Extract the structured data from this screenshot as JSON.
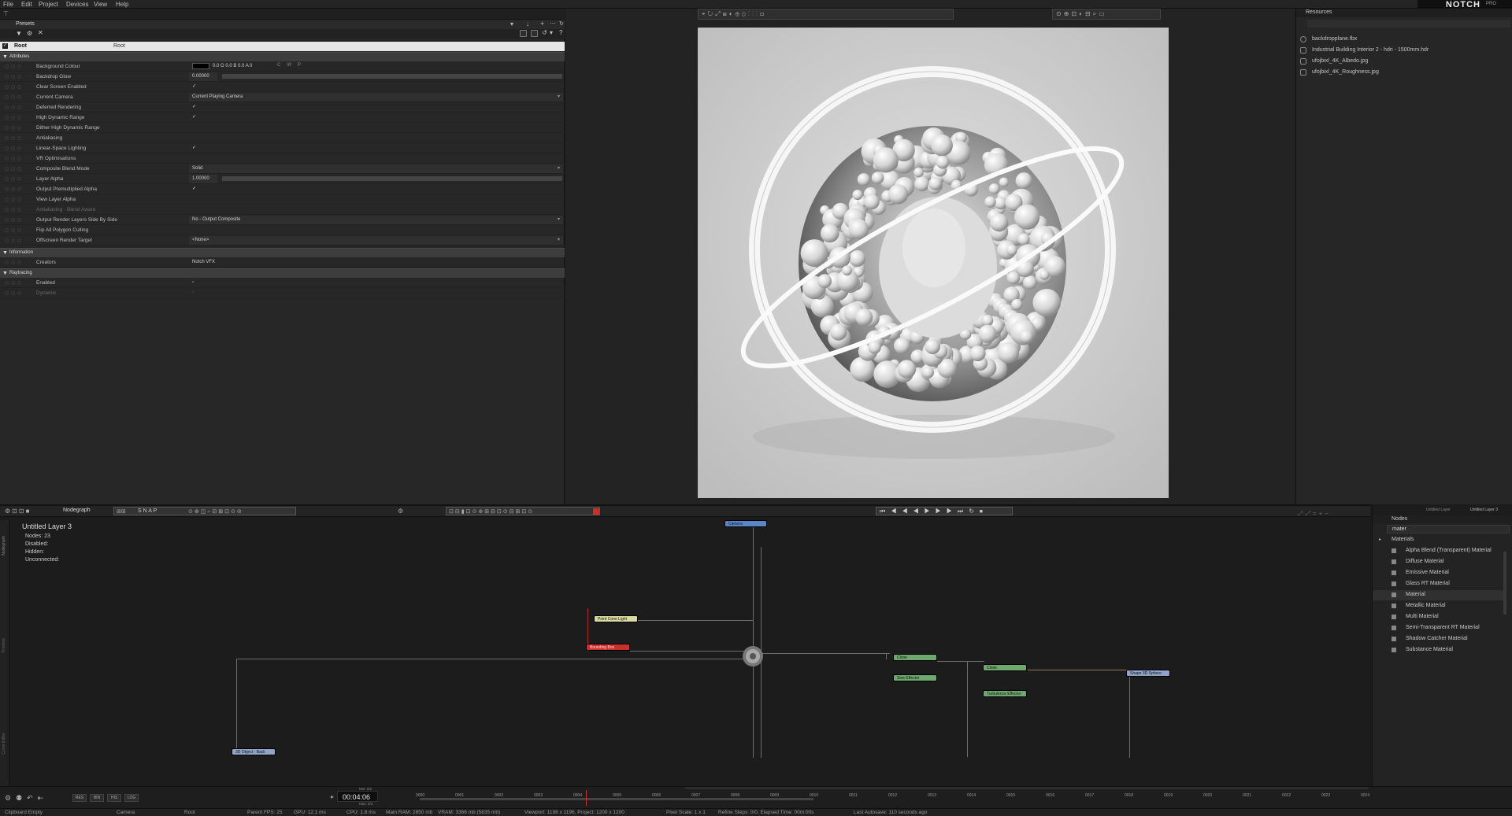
{
  "menu": [
    "File",
    "Edit",
    "Project",
    "Devices",
    "View",
    "Help"
  ],
  "brand": {
    "logo": "NOTCH",
    "edition": "PRO"
  },
  "properties": {
    "presets_label": "Presets",
    "root_label": "Root",
    "root_value": "Root",
    "attributes_header": "Attributes",
    "rows": [
      {
        "label": "Background Colour",
        "value": "0.0 G 0.0 B 0.0 A 0",
        "kind": "color"
      },
      {
        "label": "Backdrop Glow",
        "value": "0.00000",
        "kind": "number"
      },
      {
        "label": "Clear Screen Enabled",
        "value": "✓",
        "kind": "check"
      },
      {
        "label": "Current Camera",
        "value": "Current Playing Camera",
        "kind": "select"
      },
      {
        "label": "Deferred Rendering",
        "value": "✓",
        "kind": "check"
      },
      {
        "label": "High Dynamic Range",
        "value": "✓",
        "kind": "check"
      },
      {
        "label": "Dither High Dynamic Range",
        "value": "",
        "kind": "check"
      },
      {
        "label": "Antialiasing",
        "value": "",
        "kind": "check"
      },
      {
        "label": "Linear-Space Lighting",
        "value": "✓",
        "kind": "check"
      },
      {
        "label": "VR Optimisations",
        "value": "",
        "kind": "check"
      },
      {
        "label": "Composite Blend Mode",
        "value": "Solid",
        "kind": "select"
      },
      {
        "label": "Layer Alpha",
        "value": "1.00000",
        "kind": "number"
      },
      {
        "label": "Output Premultiplied Alpha",
        "value": "✓",
        "kind": "check"
      },
      {
        "label": "View Layer Alpha",
        "value": "",
        "kind": "check"
      },
      {
        "label": "Antialiasing - Blend Aware",
        "value": "",
        "kind": "check",
        "dim": true
      },
      {
        "label": "Output Render Layers Side By Side",
        "value": "No - Output Composite",
        "kind": "select"
      },
      {
        "label": "Flip All Polygon Culling",
        "value": "",
        "kind": "check"
      },
      {
        "label": "Offscreen Render Target",
        "value": "<None>",
        "kind": "select"
      }
    ],
    "information_header": "Information",
    "info_rows": [
      {
        "label": "Creators",
        "value": "Notch VFX"
      }
    ],
    "raytracing_header": "Raytracing",
    "ray_rows": [
      {
        "label": "Enabled",
        "value": "",
        "dim": false
      },
      {
        "label": "Dynamic",
        "value": "",
        "dim": true
      }
    ]
  },
  "resources": {
    "title": "Resources",
    "items": [
      "backdropplane.fbx",
      "Industrial Building Interior 2 - hdri - 1500mm.hdr",
      "ufojbixl_4K_Albedo.jpg",
      "ufojbixl_4K_Roughness.jpg"
    ]
  },
  "nodegraph": {
    "tab": "Nodegraph",
    "snap_label": "S N A P",
    "layer_title": "Untitled Layer 3",
    "stats": [
      "Nodes: 23",
      "Disabled:",
      "Hidden:",
      "Unconnected:"
    ],
    "nodes": {
      "camera": "Camera",
      "light": "Point Cone Light",
      "bounding": "Bounding Box",
      "clone1": "Clone",
      "sine": "Sine Effector",
      "clone2": "Clone",
      "turbulence": "Turbulence Effector",
      "shape": "Shape 3D Sphere",
      "object3d": "3D Object - Back"
    },
    "side_tabs": [
      "Nodegraph",
      "Timeline",
      "Curve Editor"
    ]
  },
  "nodes_panel": {
    "tab": "Nodes",
    "search_value": "mater",
    "category": "Materials",
    "items": [
      "Alpha Blend (Transparent) Material",
      "Diffuse Material",
      "Emissive Material",
      "Glass RT Material",
      "Material",
      "Metallic Material",
      "Multi Material",
      "Semi-Transparent RT Material",
      "Shadow Catcher Material",
      "Substance Material"
    ],
    "selected": "Material",
    "layer_tabs": [
      "Untitled Layer",
      "Untitled Layer 3"
    ]
  },
  "timeline": {
    "timecode": "00:04:06",
    "min_label": "Min: 0/2",
    "max_label": "Max: 0/3",
    "buttons": [
      "RES",
      "BIN",
      "HIS",
      "LOG"
    ],
    "ticks": [
      "0000",
      "0001",
      "0002",
      "0003",
      "0004",
      "0005",
      "0006",
      "0007",
      "0008",
      "0009",
      "0010",
      "0011",
      "0012",
      "0013",
      "0014",
      "0015",
      "0016",
      "0017",
      "0018",
      "0019",
      "0020",
      "0021",
      "0022",
      "0023",
      "0024"
    ]
  },
  "status": {
    "clipboard": "Clipboard Empty",
    "camera": "Camera",
    "root": "Root",
    "parent_fps": "Parent FPS: 25",
    "gpu": "GPU: 12.1 ms",
    "cpu": "CPU: 1.8 ms",
    "ram": "Main RAM: 2850 mb",
    "vram": "VRAM: 3366 mb (5835 mb)",
    "viewport": "Viewport: 1196 x 1196, Project: 1200 x 1200",
    "pixel_scale": "Pixel Scale: 1 x 1",
    "refine": "Refine Steps: 0/0, Elapsed Time: 00m:00s",
    "autosave": "Last Autosave: 110 seconds ago"
  },
  "colors": {
    "camera_node": "#5a86c8",
    "light_node": "#d9d9a0",
    "bounding_node": "#c8312a",
    "clone_node": "#6fa86f",
    "shape_node": "#8fa4c8",
    "object_node": "#8fa4c8",
    "accent_red": "#c8312a"
  }
}
